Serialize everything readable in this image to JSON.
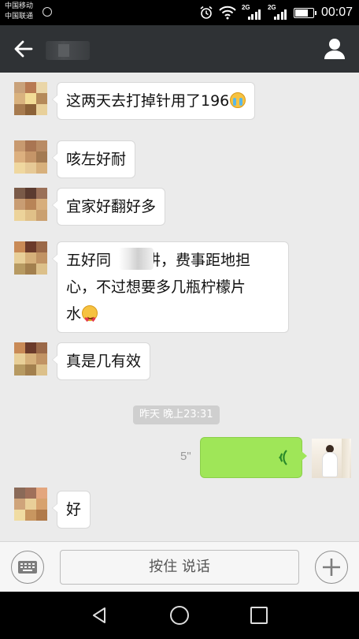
{
  "status_bar": {
    "carrier_1": "中国移动",
    "carrier_2": "中国联通",
    "network_1": "2G",
    "network_2": "2G",
    "time": "00:07",
    "battery_level": 0.75
  },
  "header": {
    "back_icon": "arrow-left-icon",
    "contact_icon": "person-icon"
  },
  "messages": [
    {
      "from": "other",
      "text": "这两天去打掉针用了196",
      "emoji": "crying-face"
    },
    {
      "from": "other",
      "text": "咳左好耐"
    },
    {
      "from": "other",
      "text": "宜家好翻好多"
    },
    {
      "from": "other",
      "line1_a": "五好同",
      "line1_b": "讲，费事距地担",
      "line2": "心，不过想要多几瓶柠檬片",
      "line3": "水",
      "emoji": "heart-eyes-face"
    },
    {
      "from": "other",
      "text": "真是几有效"
    },
    {
      "from": "me",
      "type": "voice",
      "duration": "5\""
    },
    {
      "from": "other",
      "text": "好"
    }
  ],
  "timestamp": "昨天 晚上23:31",
  "input_bar": {
    "keyboard_icon": "keyboard-icon",
    "hold_to_talk": "按住 说话",
    "plus_icon": "plus-icon"
  },
  "nav_bar": {
    "back_icon": "triangle-back-icon",
    "home_icon": "circle-home-icon",
    "recents_icon": "square-recents-icon"
  },
  "colors": {
    "header_bg": "#2f3235",
    "chat_bg": "#ebebeb",
    "my_bubble": "#9fe658",
    "other_bubble": "#ffffff"
  }
}
